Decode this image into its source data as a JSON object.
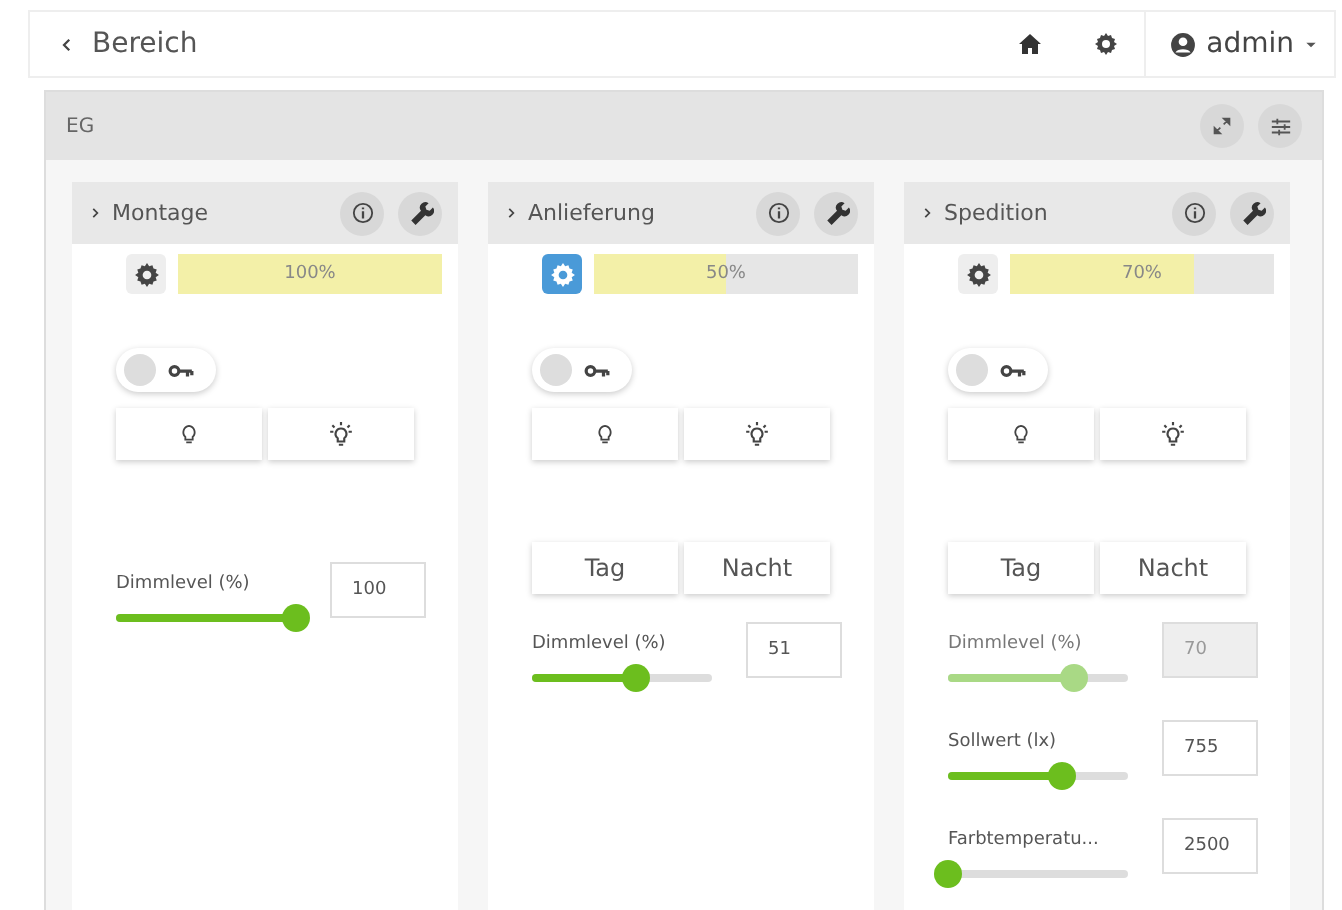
{
  "topbar": {
    "back_label": "Bereich",
    "user": "admin"
  },
  "panel": {
    "title": "EG"
  },
  "cards": [
    {
      "title": "Montage",
      "auto_active": false,
      "level": 1.0,
      "level_text": "100%",
      "key_on": false,
      "sliders": [
        {
          "label": "Dimmlevel (%)",
          "level": 1.0,
          "value": "100",
          "disabled": false
        }
      ]
    },
    {
      "title": "Anlieferung",
      "auto_active": true,
      "level": 0.5,
      "level_text": "50%",
      "key_on": false,
      "modes": [
        "Tag",
        "Nacht"
      ],
      "sliders": [
        {
          "label": "Dimmlevel (%)",
          "level": 0.58,
          "value": "51",
          "disabled": false
        }
      ]
    },
    {
      "title": "Spedition",
      "auto_active": false,
      "level": 0.7,
      "level_text": "70%",
      "key_on": false,
      "modes": [
        "Tag",
        "Nacht"
      ],
      "sliders": [
        {
          "label": "Dimmlevel (%)",
          "level": 0.7,
          "value": "70",
          "disabled": true
        },
        {
          "label": "Sollwert (lx)",
          "level": 0.63,
          "value": "755",
          "disabled": false
        },
        {
          "label": "Farbtemperatu...",
          "level": 0.0,
          "value": "2500",
          "disabled": false
        }
      ]
    }
  ]
}
